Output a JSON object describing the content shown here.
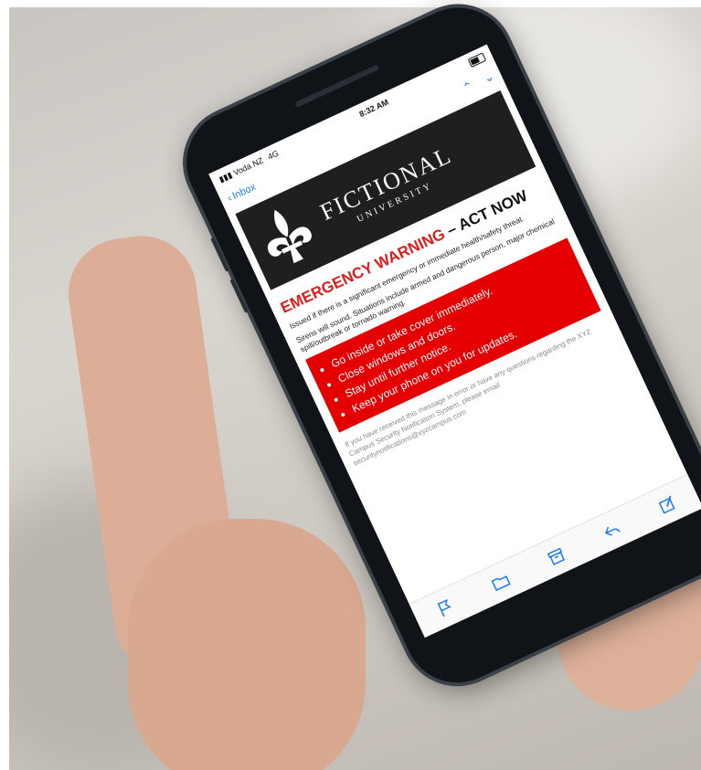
{
  "status": {
    "carrier": "Voda NZ",
    "network": "4G",
    "time": "8:32 AM"
  },
  "nav": {
    "back_label": "Inbox",
    "up_icon": "chevron-up-icon",
    "down_icon": "chevron-down-icon"
  },
  "banner": {
    "logo_icon": "fleur-de-lis-icon",
    "title": "FICTIONAL",
    "subtitle": "UNIVERSITY"
  },
  "email": {
    "heading_red": "EMERGENCY WARNING",
    "heading_black": "– ACT NOW",
    "para1": "Issued if there is a significant emergency or immediate health/safety threat.",
    "para2": "Sirens will sound. Situations include armed and dangerous person, major chemical spill/outbreak or tornado warning.",
    "bullets": [
      "Go inside or take cover immediately.",
      "Close windows and doors.",
      "Stay until further notice.",
      "Keep your phone on you for updates."
    ],
    "footer": "If you have received this message in error or have any questions regarding the XYZ Campus Security Notification System, please email securitynotifications@xyzcampus.com"
  },
  "toolbar": {
    "icons": [
      "flag-icon",
      "folder-icon",
      "archive-icon",
      "reply-icon",
      "compose-icon"
    ]
  },
  "colors": {
    "alert_red": "#e40000",
    "heading_red": "#e01b1b",
    "ios_blue": "#1a7cf5",
    "banner_bg": "#1f1f1f"
  }
}
